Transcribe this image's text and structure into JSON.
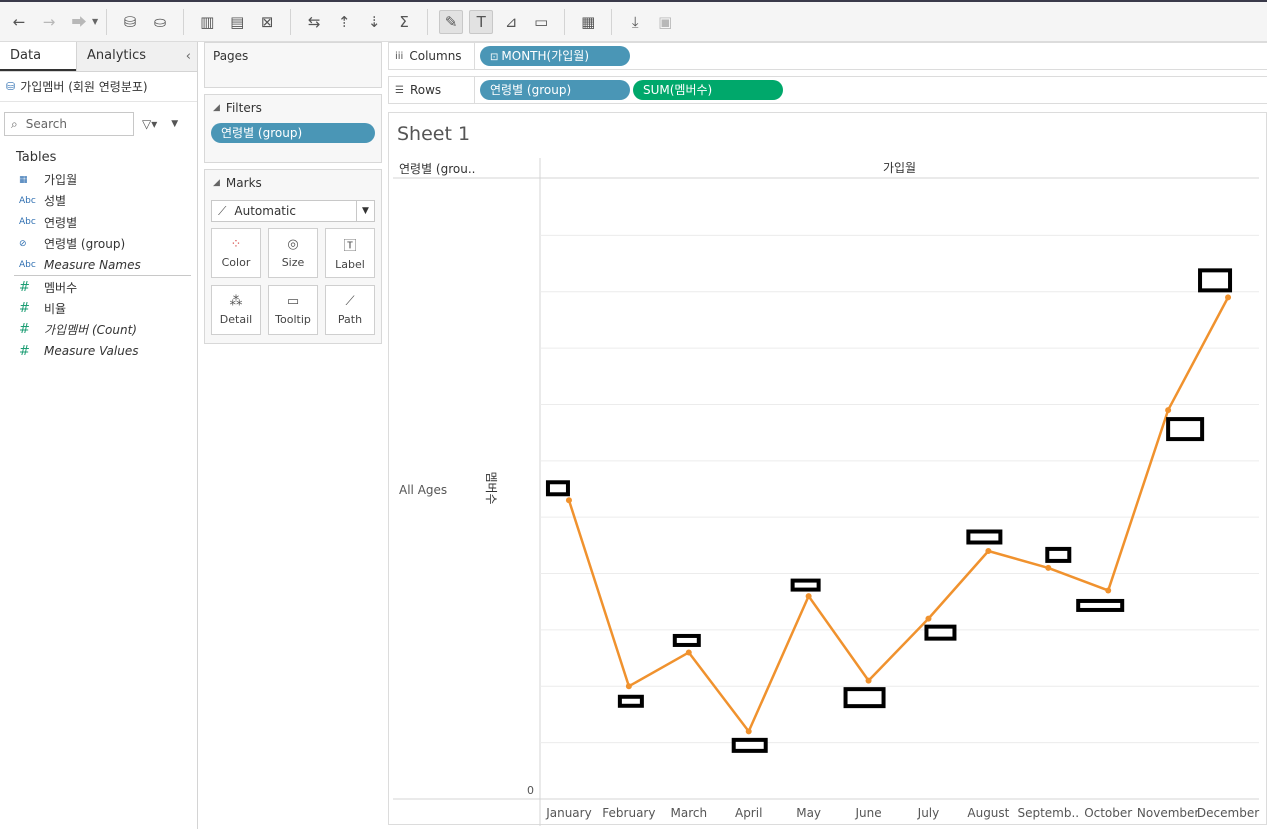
{
  "toolbar": {
    "icons": [
      "back-arrow-icon",
      "forward-arrow-icon",
      "redo-icon",
      "new-datasource-icon",
      "pause-update-icon",
      "new-worksheet-icon",
      "duplicate-icon",
      "clear-sheet-icon",
      "swap-icon",
      "sort-ascending-icon",
      "sort-descending-icon",
      "totals-icon",
      "highlight-icon",
      "show-labels-icon",
      "format-icon",
      "fit-icon",
      "show-me-icon",
      "download-icon",
      "presentation-icon"
    ]
  },
  "data_pane": {
    "tab_data": "Data",
    "tab_analytics": "Analytics",
    "datasource": "가입멤버 (회원 연령분포)",
    "search_placeholder": "Search",
    "tables_heading": "Tables",
    "dimensions": [
      {
        "icon": "calendar-icon",
        "type": "▦",
        "name": "가입월"
      },
      {
        "icon": "string-icon",
        "type": "Abc",
        "name": "성별"
      },
      {
        "icon": "string-icon",
        "type": "Abc",
        "name": "연령별"
      },
      {
        "icon": "group-icon",
        "type": "⊘",
        "name": "연령별 (group)"
      },
      {
        "icon": "string-icon",
        "type": "Abc",
        "name": "Measure Names"
      }
    ],
    "measures": [
      {
        "icon": "number-icon",
        "type": "#",
        "name": "멤버수"
      },
      {
        "icon": "number-icon",
        "type": "#",
        "name": "비율"
      },
      {
        "icon": "number-icon",
        "type": "#",
        "name": "가입멤버 (Count)"
      },
      {
        "icon": "number-icon",
        "type": "#",
        "name": "Measure Values"
      }
    ]
  },
  "cards": {
    "pages_title": "Pages",
    "filters_title": "Filters",
    "filter_pill": "연령별 (group)",
    "marks_title": "Marks",
    "mark_type": "Automatic",
    "mark_buttons": [
      "Color",
      "Size",
      "Label",
      "Detail",
      "Tooltip",
      "Path"
    ]
  },
  "shelves": {
    "columns_label": "Columns",
    "rows_label": "Rows",
    "columns_pill": "MONTH(가입월)",
    "rows_pills": [
      "연령별 (group)",
      "SUM(멤버수)"
    ]
  },
  "viz": {
    "sheet_title": "Sheet 1",
    "row_header": "연령별 (grou..",
    "column_header": "가입월",
    "row_value": "All Ages",
    "colors": {
      "line": "#f0922e",
      "grid": "#ececec"
    }
  },
  "chart_data": {
    "type": "line",
    "x_label": "가입월",
    "y_label": "멤버수",
    "categories": [
      "January",
      "February",
      "March",
      "April",
      "May",
      "June",
      "July",
      "August",
      "Septemb..",
      "October",
      "November",
      "December"
    ],
    "y_ticks": [
      "0"
    ],
    "ylim": [
      0,
      11
    ],
    "series": [
      {
        "values": [
          5.3,
          2.0,
          2.6,
          1.2,
          3.6,
          2.1,
          3.2,
          4.4,
          4.1,
          3.7,
          6.9,
          8.9
        ]
      }
    ],
    "grid": true
  }
}
